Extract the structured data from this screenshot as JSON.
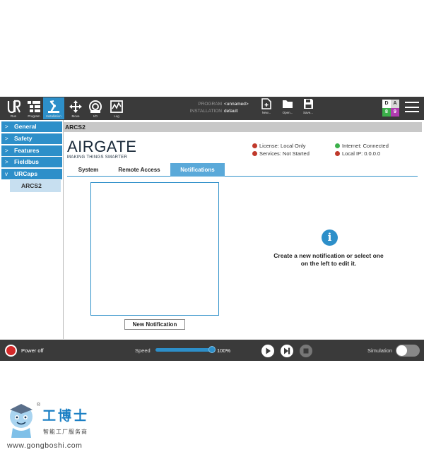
{
  "topbar": {
    "nav": [
      {
        "label": "Run"
      },
      {
        "label": "Program"
      },
      {
        "label": "Installation"
      },
      {
        "label": "Move"
      },
      {
        "label": "I/O"
      },
      {
        "label": "Log"
      }
    ],
    "program_key": "PROGRAM",
    "program_value": "<unnamed>",
    "installation_key": "INSTALLATION",
    "installation_value": "default",
    "file": [
      {
        "label": "New..."
      },
      {
        "label": "Open..."
      },
      {
        "label": "Save..."
      }
    ],
    "da": [
      "D",
      "A",
      "8",
      "9"
    ],
    "accent_color": "#2d8fc9"
  },
  "sidebar": {
    "items": [
      {
        "label": "General",
        "chev": ">"
      },
      {
        "label": "Safety",
        "chev": ">"
      },
      {
        "label": "Features",
        "chev": ">"
      },
      {
        "label": "Fieldbus",
        "chev": ">"
      },
      {
        "label": "URCaps",
        "chev": "v"
      }
    ],
    "sub_item": "ARCS2"
  },
  "main": {
    "header": "ARCS2",
    "logo": {
      "text_a": "AIR",
      "text_b": "GATE",
      "tagline": "MAKING THINGS SMARTER"
    },
    "status": [
      {
        "label": "License: Local Only",
        "color": "#c0392b"
      },
      {
        "label": "Services: Not Started",
        "color": "#c0392b"
      },
      {
        "label": "Internet: Connected",
        "color": "#3bb04a"
      },
      {
        "label": "Local IP: 0.0.0.0",
        "color": "#c0392b"
      }
    ],
    "tabs": [
      {
        "label": "System"
      },
      {
        "label": "Remote Access"
      },
      {
        "label": "Notifications"
      }
    ],
    "new_notification_label": "New Notification",
    "info_text": "Create a new notification or select one on the left to edit it.",
    "info_glyph": "i"
  },
  "bottombar": {
    "power_label": "Power off",
    "speed_label": "Speed",
    "speed_value": "100%",
    "speed_fraction": 1.0,
    "simulation_label": "Simulation"
  },
  "watermark": {
    "cn": "工博士",
    "cn2": "智能工厂服务商",
    "url": "www.gongboshi.com",
    "reg": "®"
  }
}
